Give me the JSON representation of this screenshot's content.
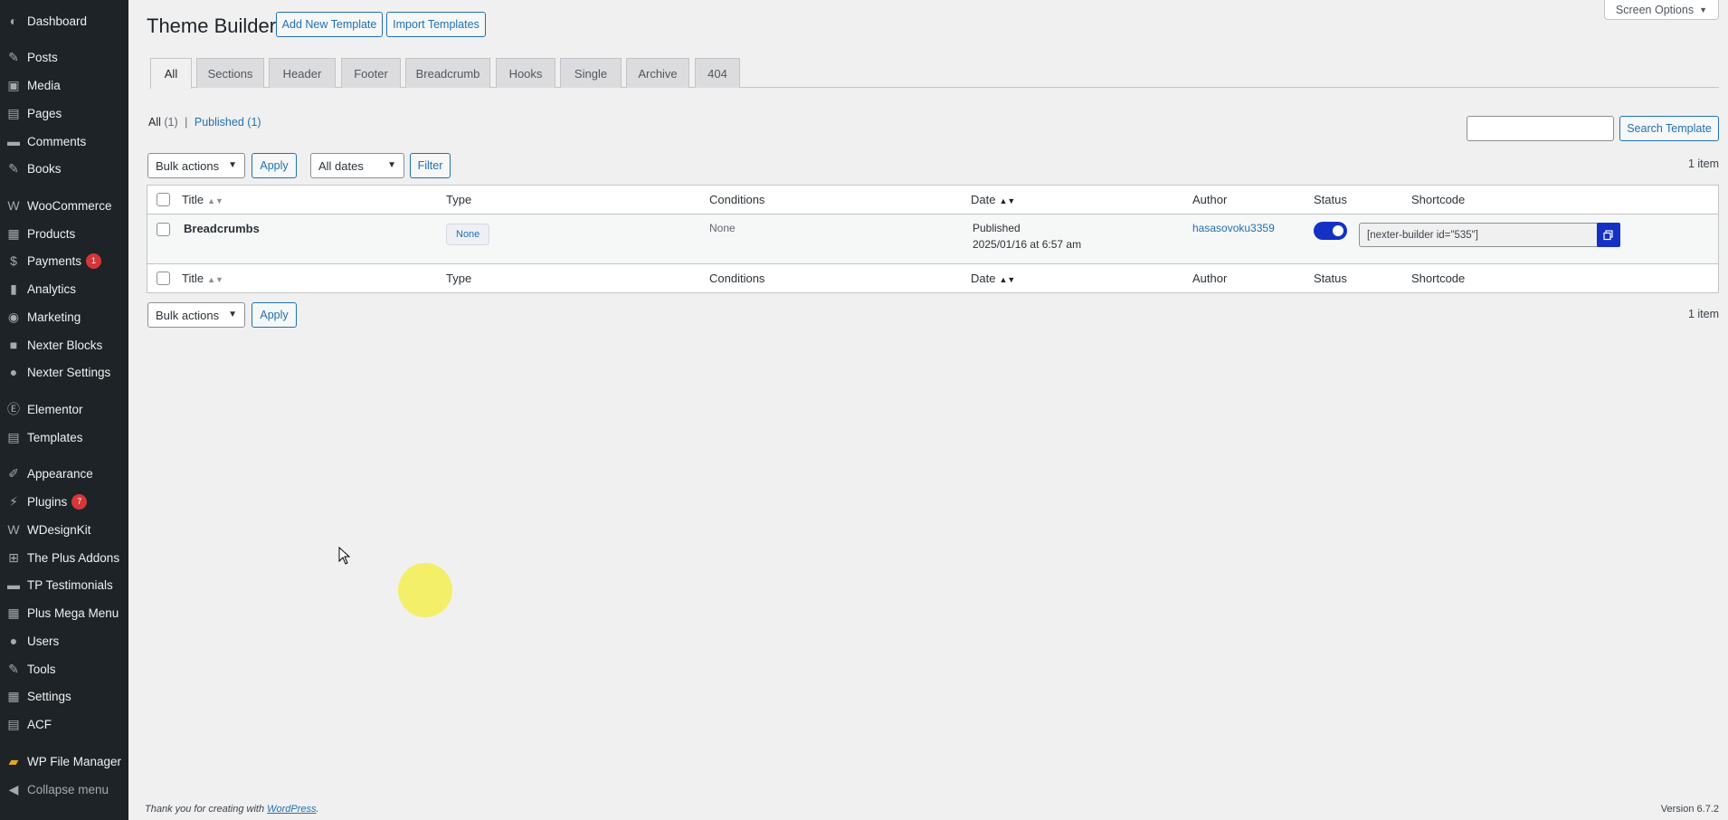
{
  "sidebar": {
    "items": [
      {
        "label": "Dashboard",
        "icon": "dashboard-icon"
      },
      {
        "label": "Posts",
        "icon": "pin-icon"
      },
      {
        "label": "Media",
        "icon": "media-icon"
      },
      {
        "label": "Pages",
        "icon": "pages-icon"
      },
      {
        "label": "Comments",
        "icon": "comments-icon"
      },
      {
        "label": "Books",
        "icon": "pin-icon"
      },
      {
        "label": "WooCommerce",
        "icon": "woocommerce-icon"
      },
      {
        "label": "Products",
        "icon": "products-icon"
      },
      {
        "label": "Payments",
        "icon": "payments-icon",
        "badge": "1"
      },
      {
        "label": "Analytics",
        "icon": "analytics-icon"
      },
      {
        "label": "Marketing",
        "icon": "megaphone-icon"
      },
      {
        "label": "Nexter Blocks",
        "icon": "nexter-blocks-icon"
      },
      {
        "label": "Nexter Settings",
        "icon": "nexter-settings-icon"
      },
      {
        "label": "Elementor",
        "icon": "elementor-icon"
      },
      {
        "label": "Templates",
        "icon": "templates-icon"
      },
      {
        "label": "Appearance",
        "icon": "brush-icon"
      },
      {
        "label": "Plugins",
        "icon": "plugin-icon",
        "badge": "7"
      },
      {
        "label": "WDesignKit",
        "icon": "wdesignkit-icon"
      },
      {
        "label": "The Plus Addons",
        "icon": "plus-addons-icon"
      },
      {
        "label": "TP Testimonials",
        "icon": "testimonials-icon"
      },
      {
        "label": "Plus Mega Menu",
        "icon": "mega-menu-icon"
      },
      {
        "label": "Users",
        "icon": "users-icon"
      },
      {
        "label": "Tools",
        "icon": "wrench-icon"
      },
      {
        "label": "Settings",
        "icon": "settings-icon"
      },
      {
        "label": "ACF",
        "icon": "acf-icon"
      },
      {
        "label": "WP File Manager",
        "icon": "folder-icon"
      },
      {
        "label": "Collapse menu",
        "icon": "collapse-icon"
      }
    ]
  },
  "header": {
    "title": "Theme Builder",
    "add_new": "Add New Template",
    "import": "Import Templates",
    "screen_options": "Screen Options"
  },
  "tabs": [
    "All",
    "Sections",
    "Header",
    "Footer",
    "Breadcrumb",
    "Hooks",
    "Single",
    "Archive",
    "404"
  ],
  "filters": {
    "all_label": "All",
    "all_count": "(1)",
    "separator": "|",
    "published_label": "Published",
    "published_count": "(1)",
    "search_value": "",
    "search_button": "Search Template",
    "bulk_actions": "Bulk actions",
    "apply": "Apply",
    "dates": "All dates",
    "filter": "Filter",
    "items_count": "1 item"
  },
  "table": {
    "columns": [
      "Title",
      "Type",
      "Conditions",
      "Date",
      "Author",
      "Status",
      "Shortcode"
    ],
    "rows": [
      {
        "title": "Breadcrumbs",
        "type": "None",
        "conditions": "None",
        "date_status": "Published",
        "date": "2025/01/16 at 6:57 am",
        "author": "hasasovoku3359",
        "status_on": true,
        "shortcode": "[nexter-builder id=\"535\"]"
      }
    ]
  },
  "footer": {
    "thanks": "Thank you for creating with",
    "wordpress": "WordPress",
    "period": ".",
    "version": "Version 6.7.2"
  },
  "colors": {
    "sidebar_bg": "#1d2327",
    "accent": "#2271b1",
    "toggle": "#1431c4",
    "badge": "#d63638"
  }
}
